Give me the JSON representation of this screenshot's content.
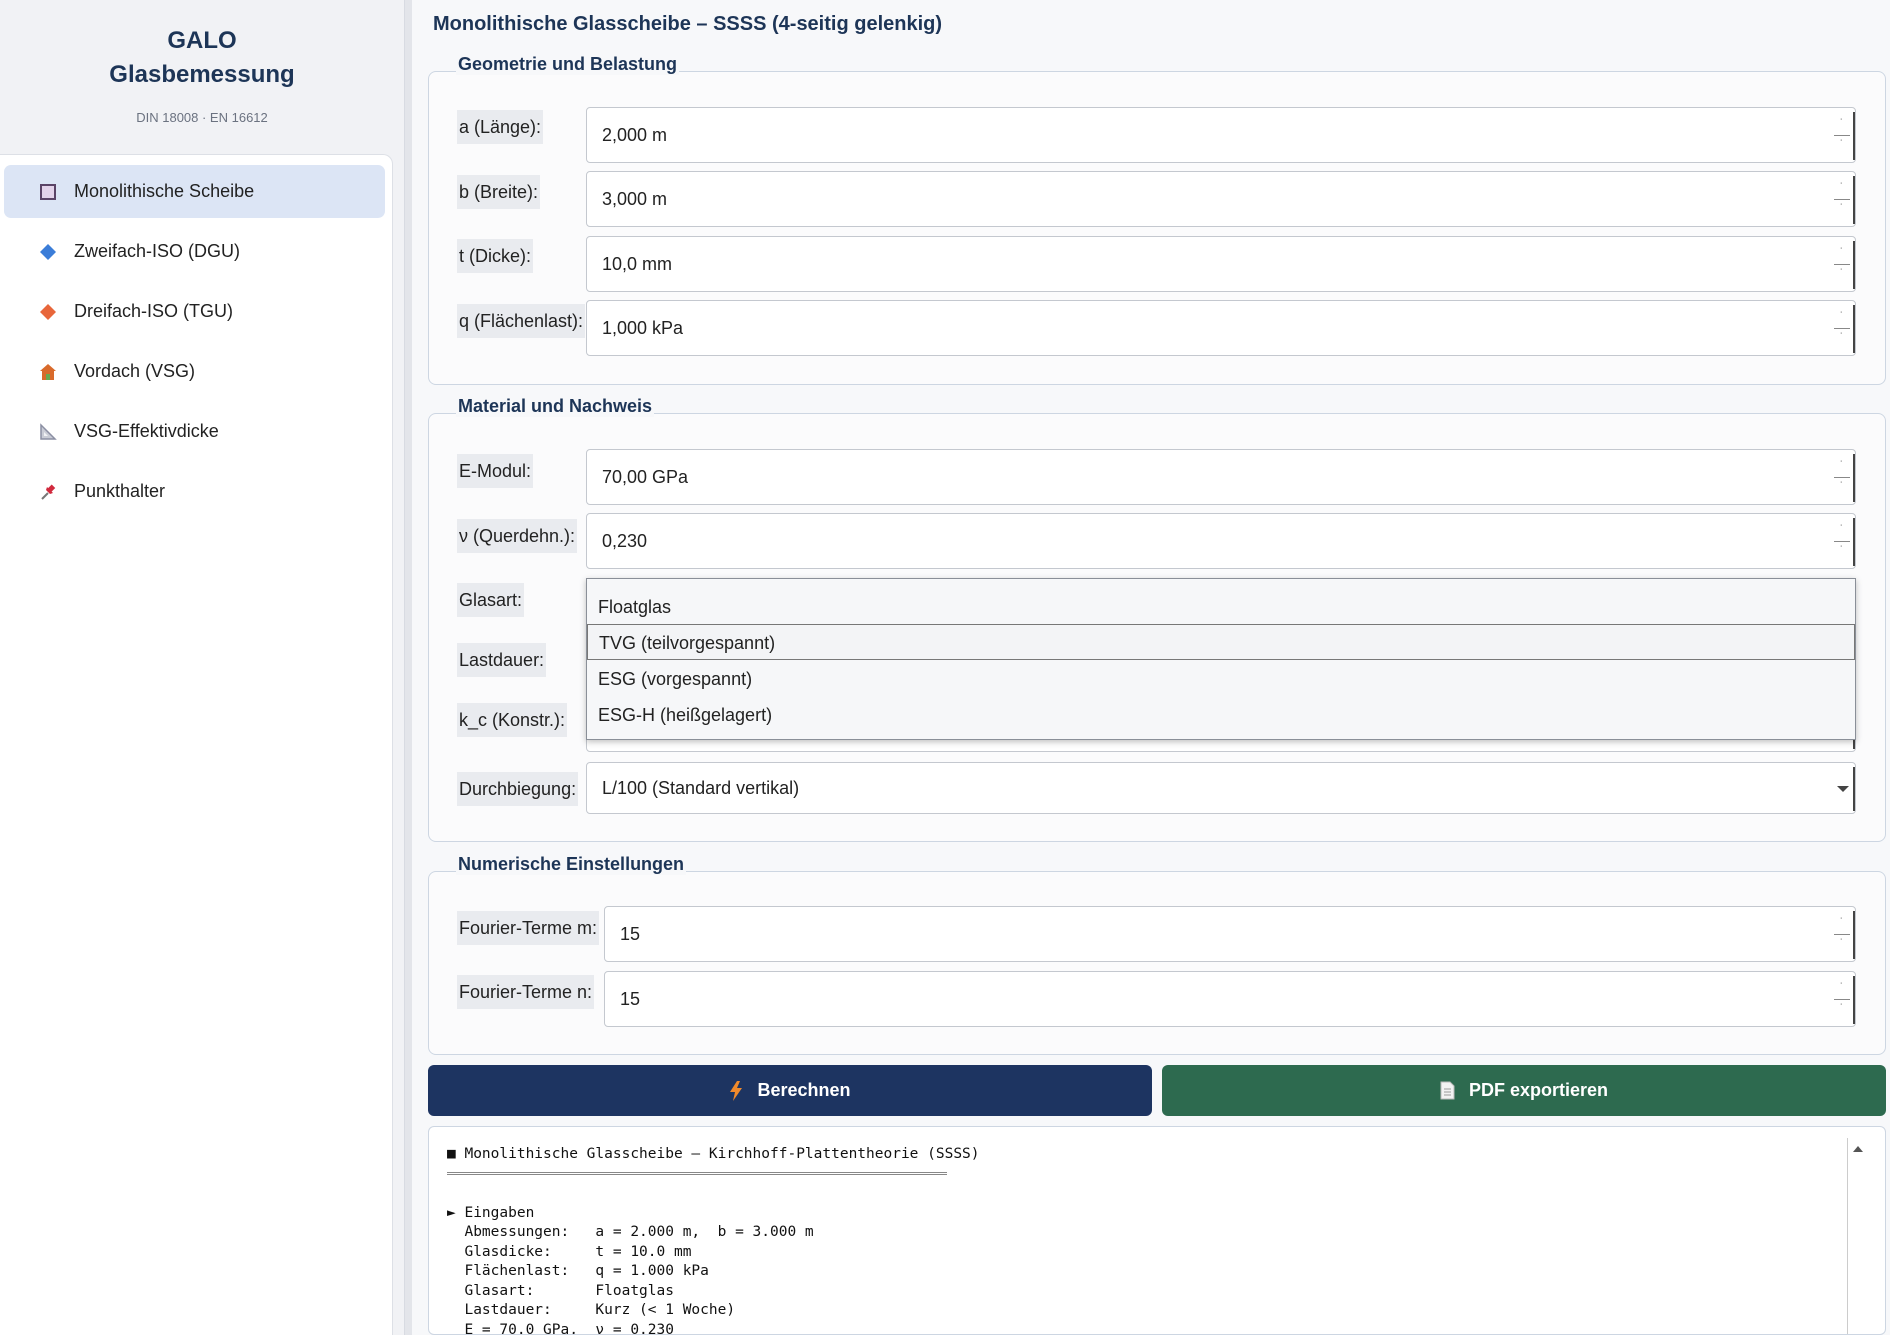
{
  "brand": {
    "line1": "GALO",
    "line2": "Glasbemessung",
    "subtitle": "DIN 18008 · EN 16612"
  },
  "nav": {
    "items": [
      {
        "label": "Monolithische Scheibe",
        "icon": "square-icon",
        "color": "#6b4f7a",
        "active": true
      },
      {
        "label": "Zweifach-ISO (DGU)",
        "icon": "blue-diamond-icon",
        "color": "#3b7dd8"
      },
      {
        "label": "Dreifach-ISO (TGU)",
        "icon": "orange-diamond-icon",
        "color": "#e8663a"
      },
      {
        "label": "Vordach (VSG)",
        "icon": "house-icon",
        "color": "#d96a2b"
      },
      {
        "label": "VSG-Effektivdicke",
        "icon": "triangular-ruler-icon",
        "color": "#8b8fa3"
      },
      {
        "label": "Punkthalter",
        "icon": "pushpin-icon",
        "color": "#d1293d"
      }
    ]
  },
  "page": {
    "title": "Monolithische Glasscheibe – SSSS (4-seitig gelenkig)"
  },
  "geometry": {
    "title": "Geometrie und Belastung",
    "fields": [
      {
        "label": "a (Länge):",
        "value": "2,000  m"
      },
      {
        "label": "b (Breite):",
        "value": "3,000  m"
      },
      {
        "label": "t (Dicke):",
        "value": "10,0  mm"
      },
      {
        "label": "q (Flächenlast):",
        "value": "1,000  kPa"
      }
    ]
  },
  "material": {
    "title": "Material und Nachweis",
    "e_label": "E-Modul:",
    "e_value": "70,00  GPa",
    "nu_label": "ν (Querdehn.):",
    "nu_value": "0,230",
    "glasart_label": "Glasart:",
    "lastdauer_label": "Lastdauer:",
    "kc_label": "k_c (Konstr.):",
    "durch_label": "Durchbiegung:",
    "durch_value": "L/100 (Standard vertikal)",
    "glasart_options": [
      "Floatglas",
      "TVG (teilvorgespannt)",
      "ESG (vorgespannt)",
      "ESG-H (heißgelagert)"
    ]
  },
  "numeric": {
    "title": "Numerische Einstellungen",
    "m_label": "Fourier-Terme m:",
    "m_value": "15",
    "n_label": "Fourier-Terme n:",
    "n_value": "15"
  },
  "actions": {
    "calc_label": "Berechnen",
    "calc_color": "#1d3461",
    "pdf_label": "PDF exportieren",
    "pdf_color": "#2d6a4f"
  },
  "output": {
    "text": "■ Monolithische Glasscheibe – Kirchhoff-Plattentheorie (SSSS)\n\n\n► Eingaben\n  Abmessungen:   a = 2.000 m,  b = 3.000 m\n  Glasdicke:     t = 10.0 mm\n  Flächenlast:   q = 1.000 kPa\n  Glasart:       Floatglas\n  Lastdauer:     Kurz (< 1 Woche)\n  E = 70.0 GPa,  ν = 0.230"
  }
}
